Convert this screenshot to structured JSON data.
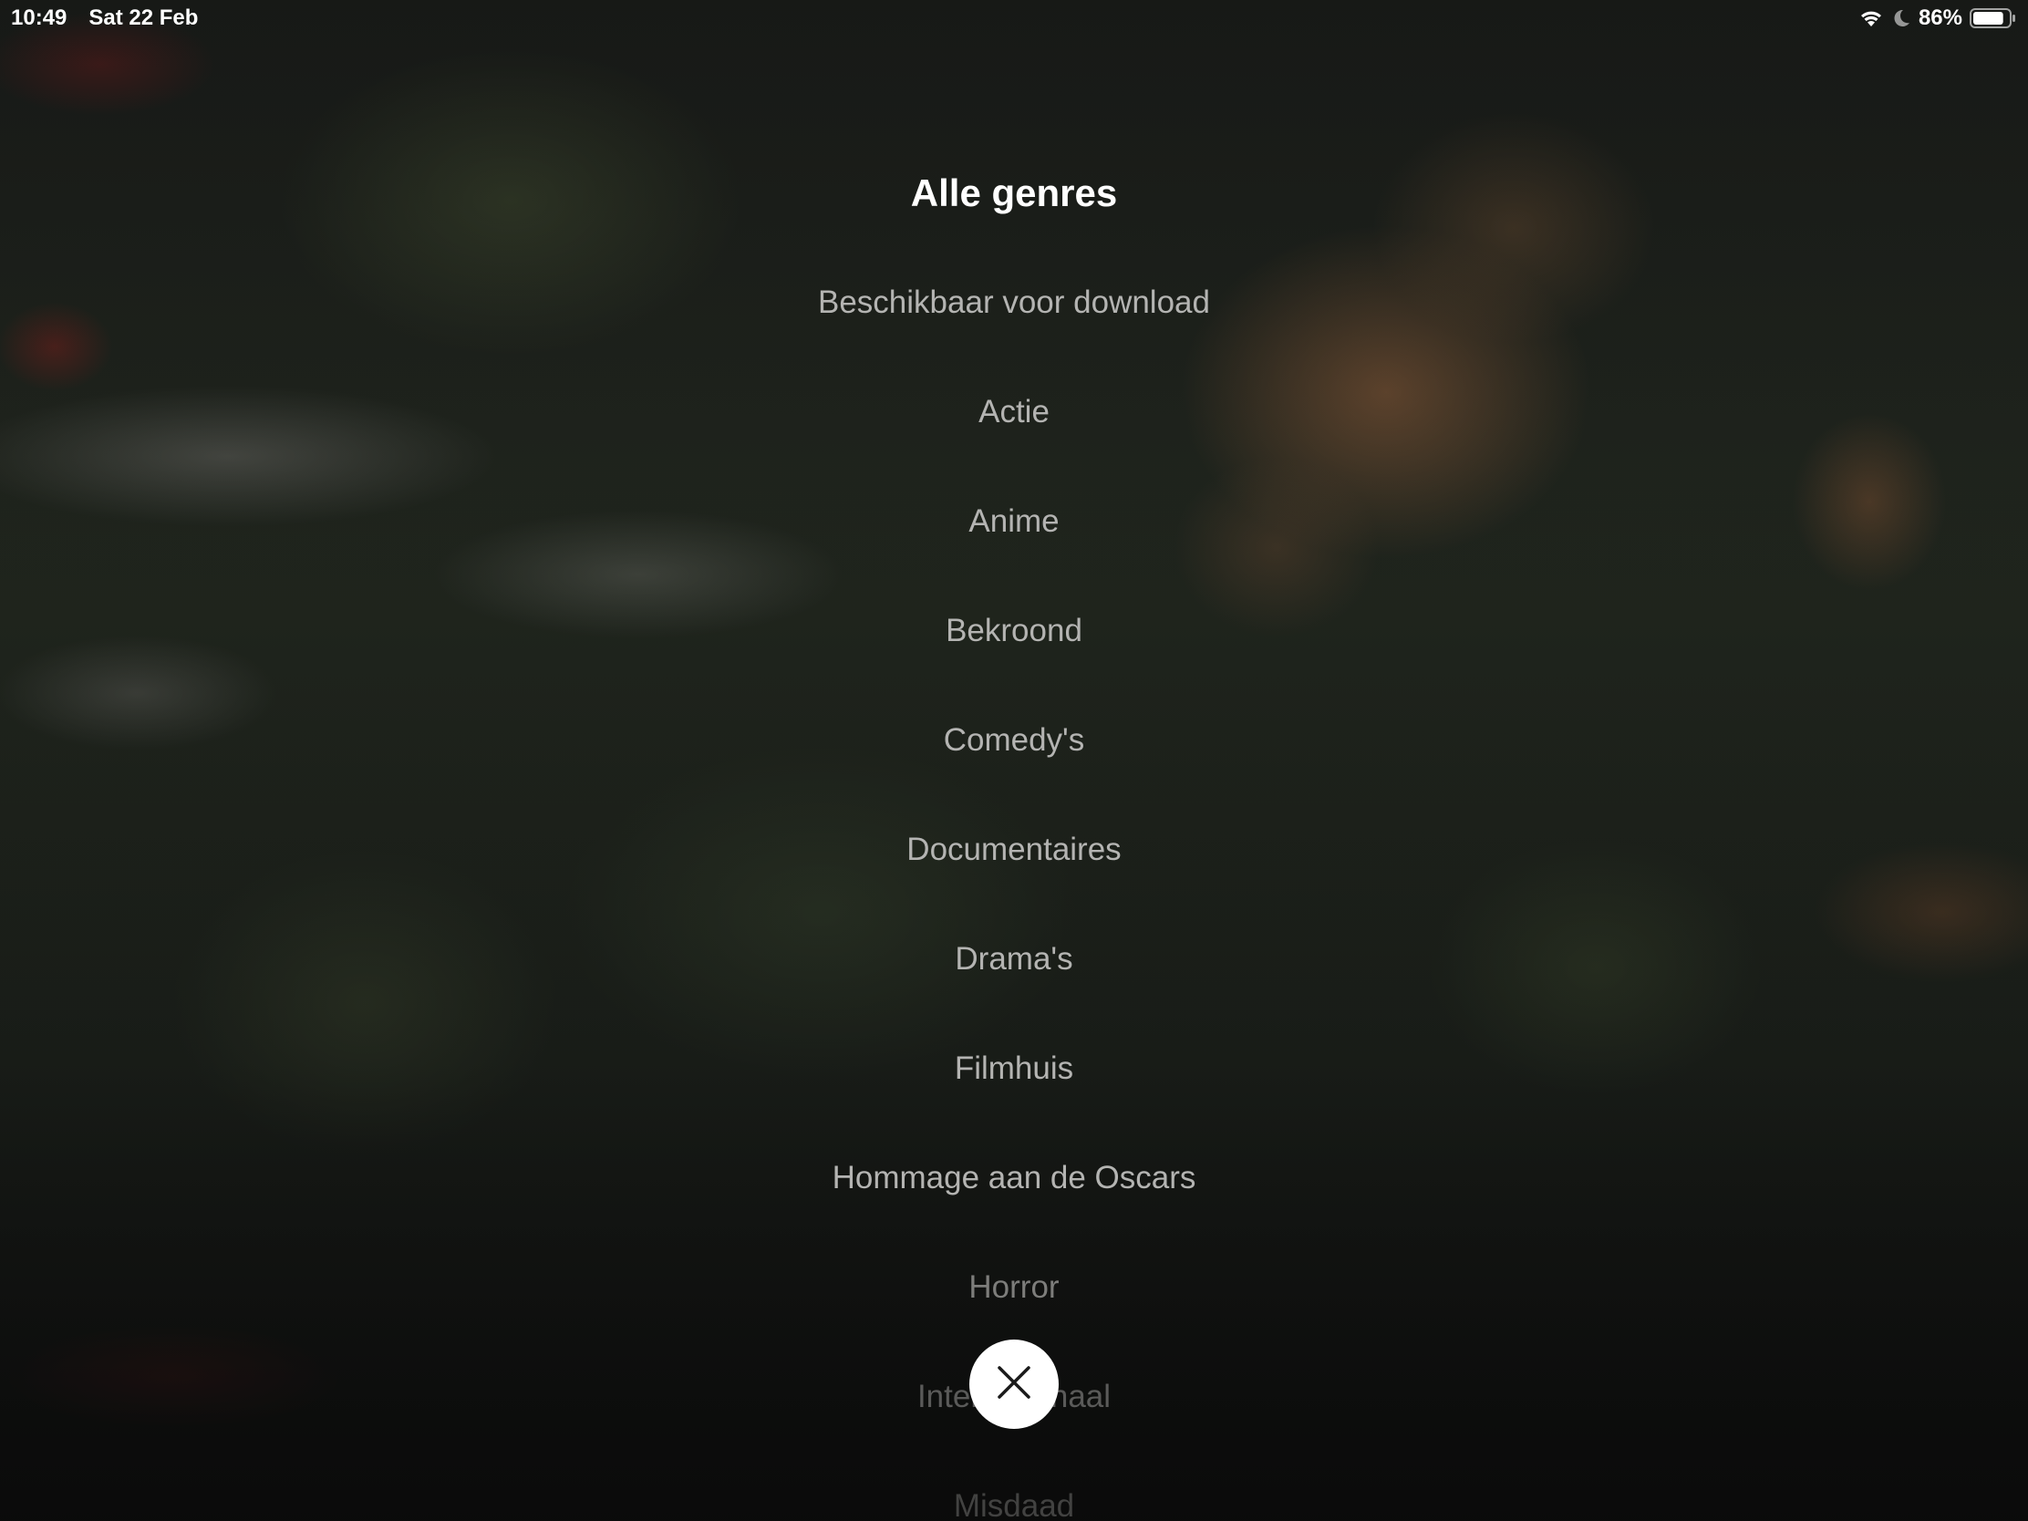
{
  "status_bar": {
    "time": "10:49",
    "date": "Sat 22 Feb",
    "battery_percent": "86%",
    "battery_level": 0.86,
    "icons": [
      "wifi-icon",
      "moon-icon",
      "battery-icon"
    ]
  },
  "menu": {
    "title": "Alle genres",
    "genres": [
      "Beschikbaar voor download",
      "Actie",
      "Anime",
      "Bekroond",
      "Comedy's",
      "Documentaires",
      "Drama's",
      "Filmhuis",
      "Hommage aan de Oscars",
      "Horror",
      "Internationaal",
      "Misdaad"
    ]
  },
  "close_button": {
    "icon": "close-icon"
  },
  "colors": {
    "title_text": "#ffffff",
    "genre_text": "#b4b4b2",
    "close_button_bg": "#ffffff",
    "close_icon": "#1a1a1a"
  }
}
